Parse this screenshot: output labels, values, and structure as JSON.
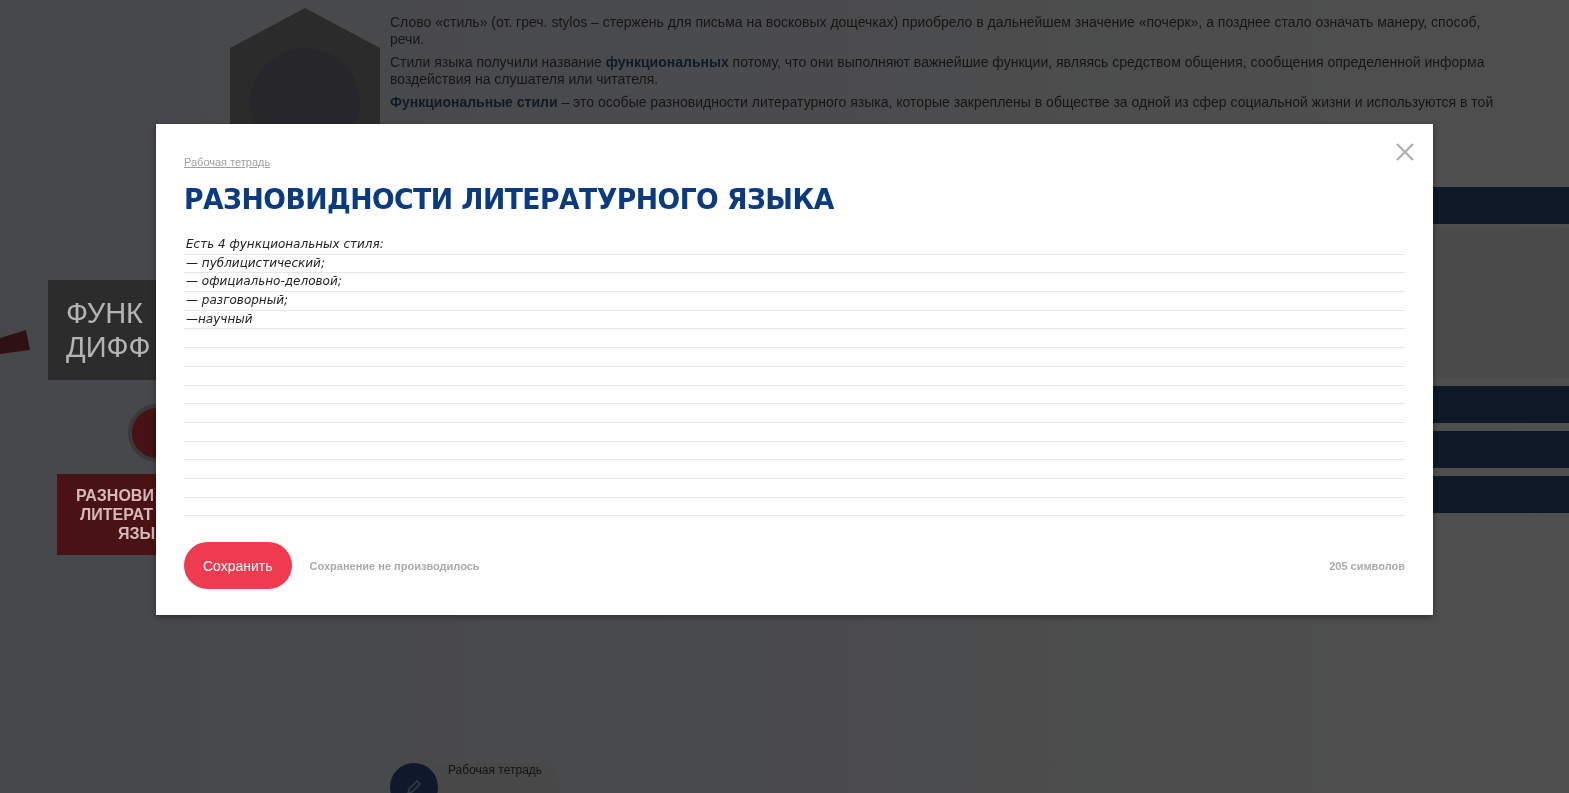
{
  "page": {
    "paragraphs": [
      {
        "lines": [
          "Слово «стиль» (от. греч. stylos – стержень для письма на восковых дощечках) приобрело в дальнейшем значение «почерк», а позднее стало означать манеру, способ,",
          "речи."
        ]
      },
      {
        "lines": [
          "Стили языка получили название **функциональных** потому, что они выполняют важнейшие функции, являясь средством общения, сообщения определенной информа",
          "воздействия на слушателя или читателя."
        ]
      },
      {
        "lines": [
          "**Функциональные стили** – это особые разновидности литературного языка, которые закреплены в обществе за одной из сфер социальной жизни и используются в той"
        ]
      }
    ],
    "topic_box": {
      "lines": [
        "ФУНК",
        "ДИФФ"
      ]
    },
    "topic_banner": {
      "lines": [
        "РАЗНОВИ",
        "ЛИТЕРАТ",
        "ЯЗЫ"
      ]
    },
    "workbook_button": {
      "label": "Рабочая тетрадь"
    }
  },
  "dialog": {
    "breadcrumb": "Рабочая тетрадь",
    "title": "РАЗНОВИДНОСТИ ЛИТЕРАТУРНОГО ЯЗЫКА",
    "notebook": {
      "lines": [
        "Есть 4 функциональных стиля:",
        "— публицистический;",
        "— официально-деловой;",
        "— разговорный;",
        "—научный"
      ]
    },
    "save_button": "Сохранить",
    "save_status": "Сохранение не производилось",
    "char_count": "205 символов"
  }
}
